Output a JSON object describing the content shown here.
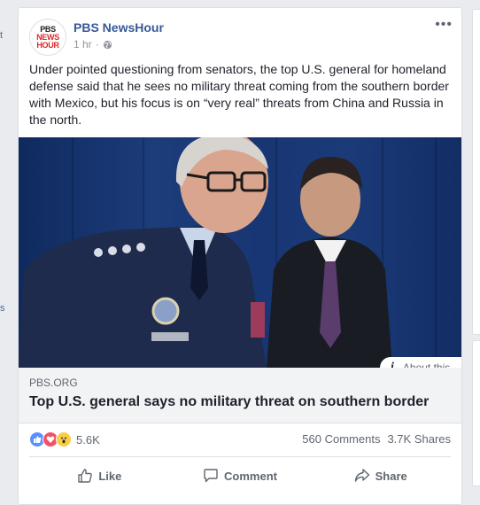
{
  "left_edge": {
    "top_glyph": "t",
    "mid_glyph": "s"
  },
  "post": {
    "page_name": "PBS NewsHour",
    "logo": {
      "line1": "PBS",
      "line2": "NEWS",
      "line3": "HOUR"
    },
    "time": "1 hr",
    "separator": "·",
    "more": "•••",
    "text": "Under pointed questioning from senators, the top U.S. general for homeland defense said that he sees no military threat coming from the southern border with Mexico, but his focus is on “very real” threats from China and Russia in the north."
  },
  "link": {
    "about_label": "About this",
    "domain": "PBS.ORG",
    "title": "Top U.S. general says no military threat on southern border"
  },
  "engagement": {
    "reactions_count": "5.6K",
    "comments": "560 Comments",
    "shares": "3.7K Shares"
  },
  "actions": {
    "like": "Like",
    "comment": "Comment",
    "share": "Share"
  },
  "colors": {
    "link_blue": "#365899",
    "secondary_text": "#606770",
    "photo_background": "#1c3c7a"
  }
}
